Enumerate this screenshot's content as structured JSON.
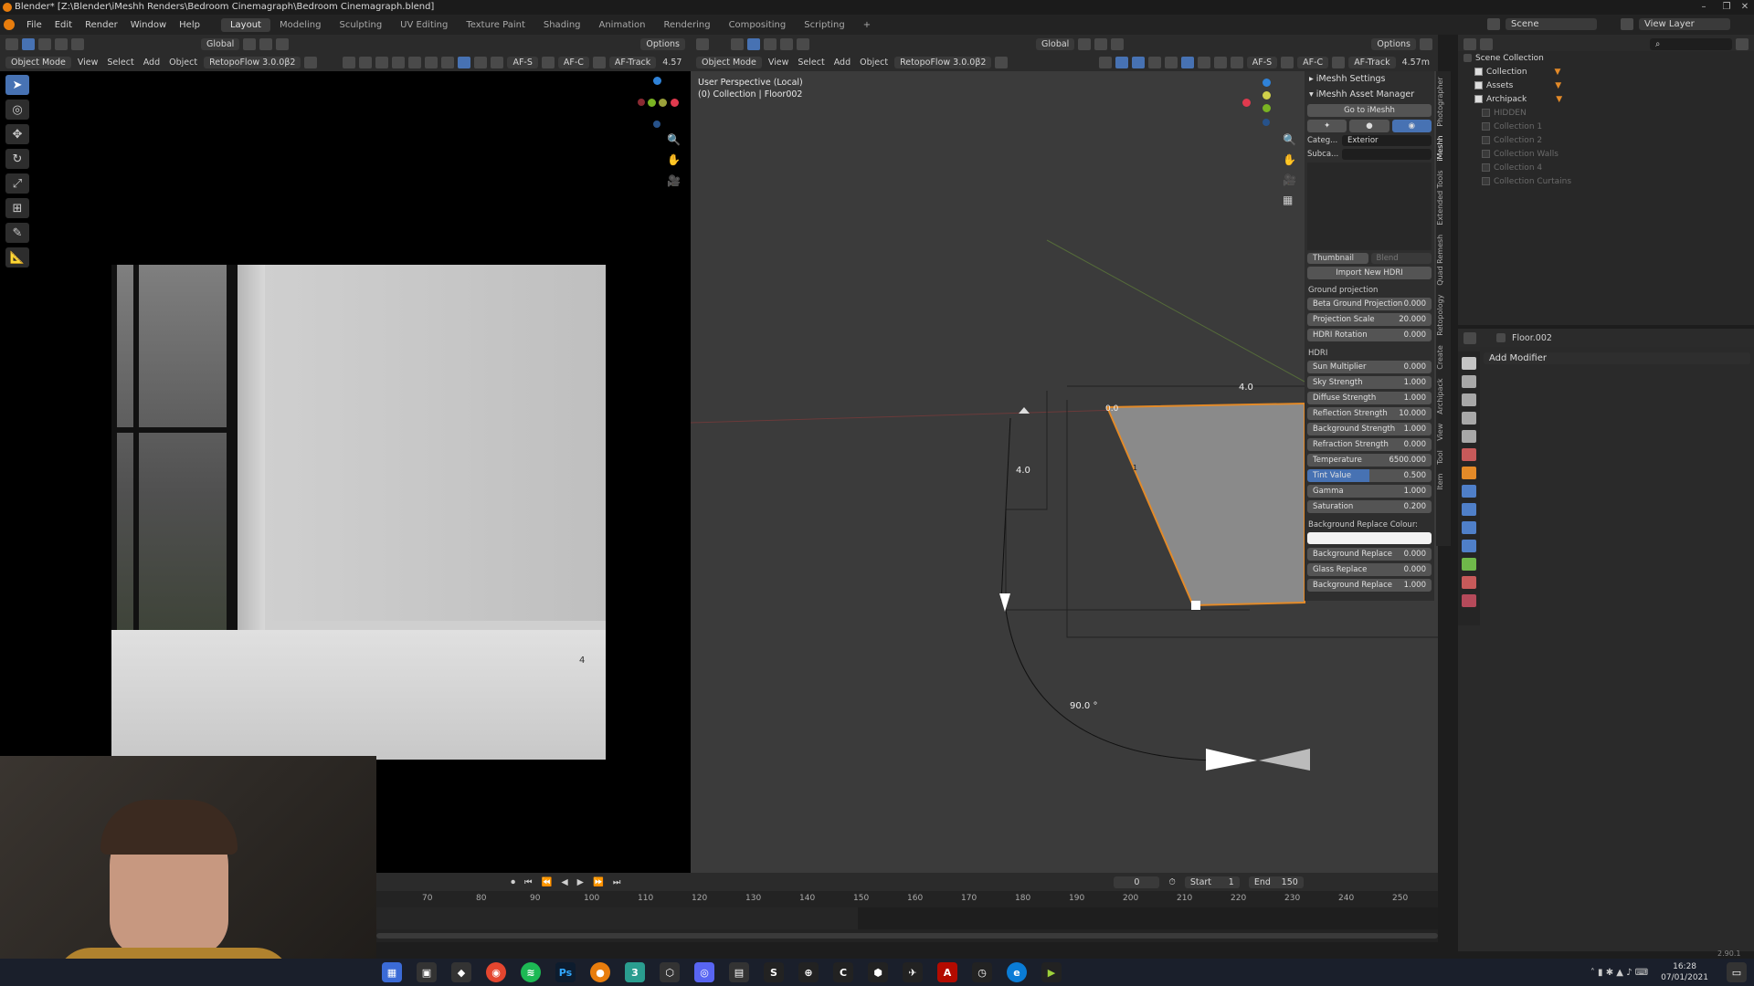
{
  "window": {
    "title": "Blender* [Z:\\Blender\\iMeshh Renders\\Bedroom Cinemagraph\\Bedroom Cinemagraph.blend]",
    "min": "–",
    "max": "❐",
    "close": "✕"
  },
  "menu": [
    "File",
    "Edit",
    "Render",
    "Window",
    "Help"
  ],
  "workspaces": [
    {
      "label": "Layout",
      "active": true
    },
    {
      "label": "Modeling"
    },
    {
      "label": "Sculpting"
    },
    {
      "label": "UV Editing"
    },
    {
      "label": "Texture Paint"
    },
    {
      "label": "Shading"
    },
    {
      "label": "Animation"
    },
    {
      "label": "Rendering"
    },
    {
      "label": "Compositing"
    },
    {
      "label": "Scripting"
    }
  ],
  "scene": {
    "scene_label": "Scene",
    "view_layer_label": "View Layer"
  },
  "left_header": {
    "mode": "Object Mode",
    "view": "View",
    "select": "Select",
    "add": "Add",
    "object": "Object",
    "retopo": "RetopoFlow 3.0.0β2",
    "orientation": "Global",
    "options": "Options",
    "afs": "AF-S",
    "afc": "AF-C",
    "aftrack": "AF-Track",
    "focal": "4.57"
  },
  "right_header": {
    "mode": "Object Mode",
    "view": "View",
    "select": "Select",
    "add": "Add",
    "object": "Object",
    "retopo": "RetopoFlow 3.0.0β2",
    "orientation": "Global",
    "options": "Options",
    "afs": "AF-S",
    "afc": "AF-C",
    "aftrack": "AF-Track",
    "focal": "4.57m"
  },
  "viewport_info": {
    "line1": "User Perspective (Local)",
    "line2": "(0) Collection | Floor002"
  },
  "render_preview": {
    "label": "4"
  },
  "viewport_annotations": {
    "dim_top": "4.0",
    "dim_left": "4.0",
    "dim_zero": "0.0",
    "angle": "90.0 °",
    "edge_one": "1"
  },
  "npanel": {
    "settings": "iMeshh Settings",
    "asset_manager": "iMeshh Asset Manager",
    "goto": "Go to iMeshh",
    "category_label": "Categ...",
    "category_value": "Exterior",
    "subcategory_label": "Subca...",
    "thumbnail": "Thumbnail",
    "blend": "Blend",
    "import_hdri": "Import New HDRI",
    "ground_projection": "Ground projection",
    "ground_rows": [
      {
        "label": "Beta Ground Projection",
        "value": "0.000"
      },
      {
        "label": "Projection Scale",
        "value": "20.000"
      },
      {
        "label": "HDRI Rotation",
        "value": "0.000"
      }
    ],
    "hdri_section": "HDRI",
    "hdri_rows": [
      {
        "label": "Sun Multiplier",
        "value": "0.000"
      },
      {
        "label": "Sky Strength",
        "value": "1.000"
      },
      {
        "label": "Diffuse Strength",
        "value": "1.000"
      },
      {
        "label": "Reflection Strength",
        "value": "10.000"
      },
      {
        "label": "Background Strength",
        "value": "1.000"
      },
      {
        "label": "Refraction Strength",
        "value": "0.000"
      },
      {
        "label": "Temperature",
        "value": "6500.000"
      },
      {
        "label": "Tint Value",
        "value": "0.500",
        "fill": 0.5
      },
      {
        "label": "Gamma",
        "value": "1.000"
      },
      {
        "label": "Saturation",
        "value": "0.200"
      }
    ],
    "bg_colour_label": "Background Replace Colour:",
    "bg_rows": [
      {
        "label": "Background Replace",
        "value": "0.000"
      },
      {
        "label": "Glass Replace",
        "value": "0.000"
      },
      {
        "label": "Background Replace",
        "value": "1.000"
      }
    ]
  },
  "side_tabs": [
    "Item",
    "Tool",
    "View",
    "Archipack",
    "Create",
    "Retopology",
    "Quad Remesh",
    "Extended Tools",
    "iMeshh",
    "Photographer"
  ],
  "outliner": {
    "root": "Scene Collection",
    "items": [
      {
        "label": "Collection",
        "on": true
      },
      {
        "label": "Assets",
        "on": true
      },
      {
        "label": "Archipack",
        "on": true
      },
      {
        "label": "HIDDEN",
        "on": false
      },
      {
        "label": "Collection 1",
        "on": false
      },
      {
        "label": "Collection 2",
        "on": false
      },
      {
        "label": "Collection Walls",
        "on": false
      },
      {
        "label": "Collection 4",
        "on": false
      },
      {
        "label": "Collection Curtains",
        "on": false
      }
    ]
  },
  "properties": {
    "object_name": "Floor.002",
    "add_modifier": "Add Modifier"
  },
  "timeline": {
    "current": "0",
    "start_label": "Start",
    "start": "1",
    "end_label": "End",
    "end": "150",
    "ticks": [
      "70",
      "80",
      "90",
      "100",
      "110",
      "120",
      "130",
      "140",
      "150",
      "160",
      "170",
      "180",
      "190",
      "200",
      "210",
      "220",
      "230",
      "240",
      "250"
    ]
  },
  "version": "2.90.1",
  "taskbar": {
    "time": "16:28",
    "date": "07/01/2021"
  }
}
